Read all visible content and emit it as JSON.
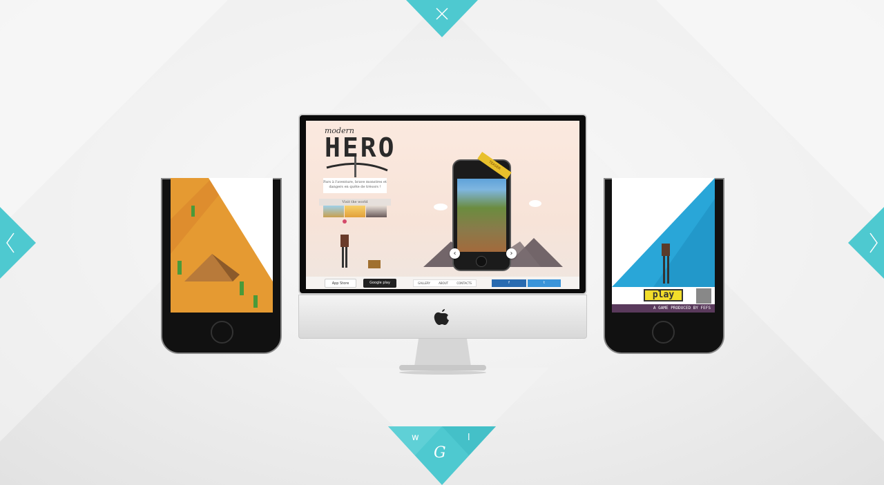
{
  "colors": {
    "accent": "#4ec9d0",
    "accent_dark": "#38b6bf",
    "background": "#ececec"
  },
  "nav": {
    "close_icon": "close-icon",
    "prev_icon": "chevron-left-icon",
    "next_icon": "chevron-right-icon"
  },
  "monitor": {
    "site": {
      "title_small": "modern",
      "title_large": "HERO",
      "tagline": "Pars à l'aventure, brave monstres et dangers en quête de trésors !",
      "visit_label": "Visit the world",
      "ribbon": "TEASER",
      "nav_items": [
        "GALLERY",
        "ABOUT",
        "CONTACTS"
      ],
      "store_badges": [
        "App Store",
        "Google play"
      ],
      "social": [
        "f",
        "t"
      ]
    }
  },
  "right_phone": {
    "play_label": "play",
    "credit": "A GAME PRODUCED BY FEFS"
  },
  "bottom_tab": {
    "left_letter": "w",
    "right_letter": "l",
    "logo": "G"
  }
}
